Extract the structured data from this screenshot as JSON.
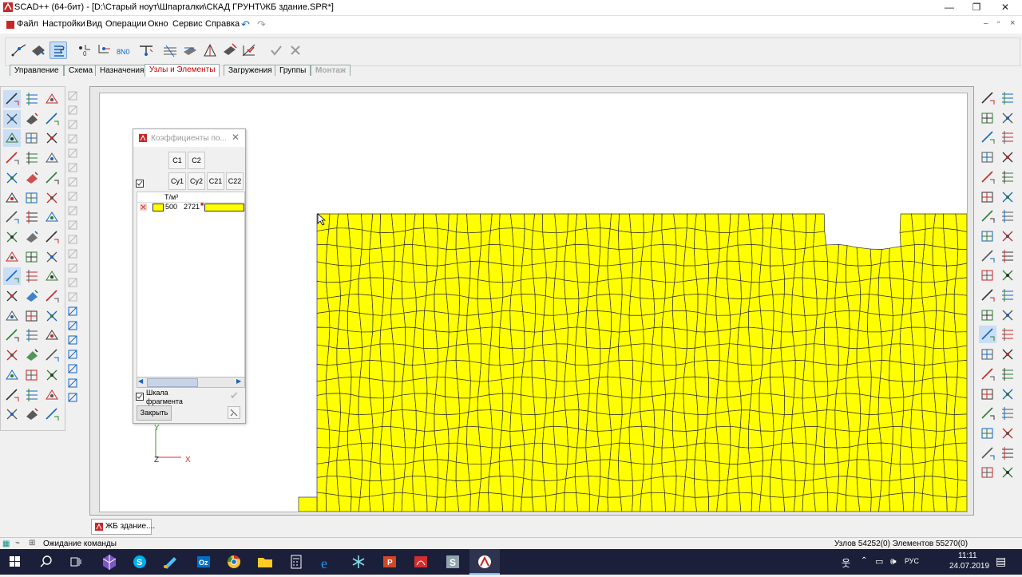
{
  "window": {
    "title": "SCAD++ (64-бит) - [D:\\Старый ноут\\Шпаргалки\\СКАД ГРУНТ\\ЖБ здание.SPR*]",
    "controls": [
      "—",
      "❐",
      "✕"
    ]
  },
  "menu": {
    "items": [
      "Файл",
      "Настройки",
      "Вид",
      "Операции",
      "Окно",
      "Сервис",
      "Справка"
    ],
    "mdi_controls": [
      "–",
      "▫",
      "×"
    ]
  },
  "tabs": [
    {
      "label": "Управление",
      "state": "normal"
    },
    {
      "label": "Схема",
      "state": "normal"
    },
    {
      "label": "Назначения",
      "state": "normal"
    },
    {
      "label": "Узлы и Элементы",
      "state": "selected"
    },
    {
      "label": "Загружения",
      "state": "normal"
    },
    {
      "label": "Группы",
      "state": "normal"
    },
    {
      "label": "Монтаж",
      "state": "disabled"
    }
  ],
  "dialog": {
    "title": "Коэффициенты по...",
    "buttons_row1": [
      "C1",
      "C2"
    ],
    "buttons_row2": [
      "Cy1",
      "Cy2",
      "C21",
      "C22"
    ],
    "column_header": "Т/м³",
    "row": {
      "value": "500",
      "count": "2721",
      "color": "#ffff00"
    },
    "checkbox_label_line1": "Шкала",
    "checkbox_label_line2": "фрагмента",
    "close_label": "Закрыть"
  },
  "axes": {
    "y": "Y",
    "z": "Z",
    "x": "X"
  },
  "doc_tab": "ЖБ здание....",
  "status": {
    "left": "Ожидание команды",
    "right": "Узлов 54252(0) Элементов 55270(0)"
  },
  "taskbar": {
    "lang": "РУС",
    "time": "11:11",
    "date": "24.07.2019"
  },
  "colors": {
    "mesh_fill": "#ffff00",
    "mesh_line": "#333333",
    "selected_tab_text": "#c00000",
    "taskbar_bg": "#1b1f3a"
  }
}
